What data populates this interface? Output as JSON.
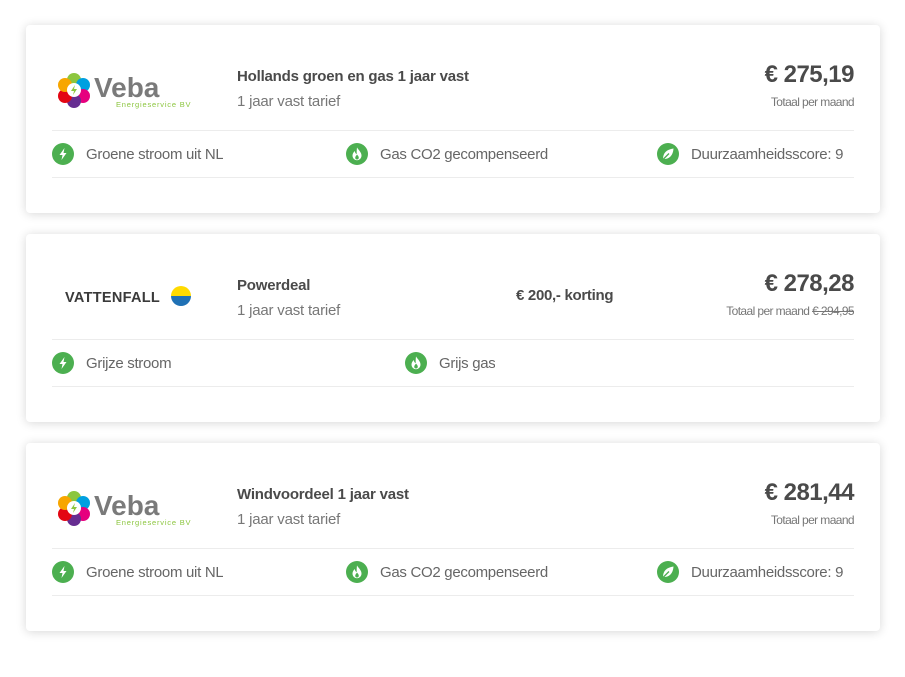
{
  "offers": [
    {
      "provider": {
        "name": "Veba",
        "tagline": "Energieservice BV"
      },
      "product": "Hollands groen en gas 1 jaar vast",
      "tariff": "1 jaar vast tarief",
      "price": "€ 275,19",
      "price_label": "Totaal per maand",
      "features": [
        {
          "icon": "bolt-icon",
          "label": "Groene stroom uit NL"
        },
        {
          "icon": "flame-icon",
          "label": "Gas CO2 gecompenseerd"
        },
        {
          "icon": "leaf-icon",
          "label": "Duurzaamheidsscore: 9"
        }
      ]
    },
    {
      "provider": {
        "name": "VATTENFALL"
      },
      "product": "Powerdeal",
      "tariff": "1 jaar vast tarief",
      "discount": "€ 200,- korting",
      "price": "€ 278,28",
      "price_label": "Totaal per maand",
      "old_price": "€ 294,95",
      "features": [
        {
          "icon": "bolt-icon",
          "label": "Grijze stroom"
        },
        {
          "icon": "flame-icon",
          "label": "Grijs gas"
        }
      ]
    },
    {
      "provider": {
        "name": "Veba",
        "tagline": "Energieservice BV"
      },
      "product": "Windvoordeel 1 jaar vast",
      "tariff": "1 jaar vast tarief",
      "price": "€ 281,44",
      "price_label": "Totaal per maand",
      "features": [
        {
          "icon": "bolt-icon",
          "label": "Groene stroom uit NL"
        },
        {
          "icon": "flame-icon",
          "label": "Gas CO2 gecompenseerd"
        },
        {
          "icon": "leaf-icon",
          "label": "Duurzaamheidsscore: 9"
        }
      ]
    }
  ],
  "colors": {
    "accent_green": "#4caf50",
    "text_dark": "#4a4a4a"
  }
}
